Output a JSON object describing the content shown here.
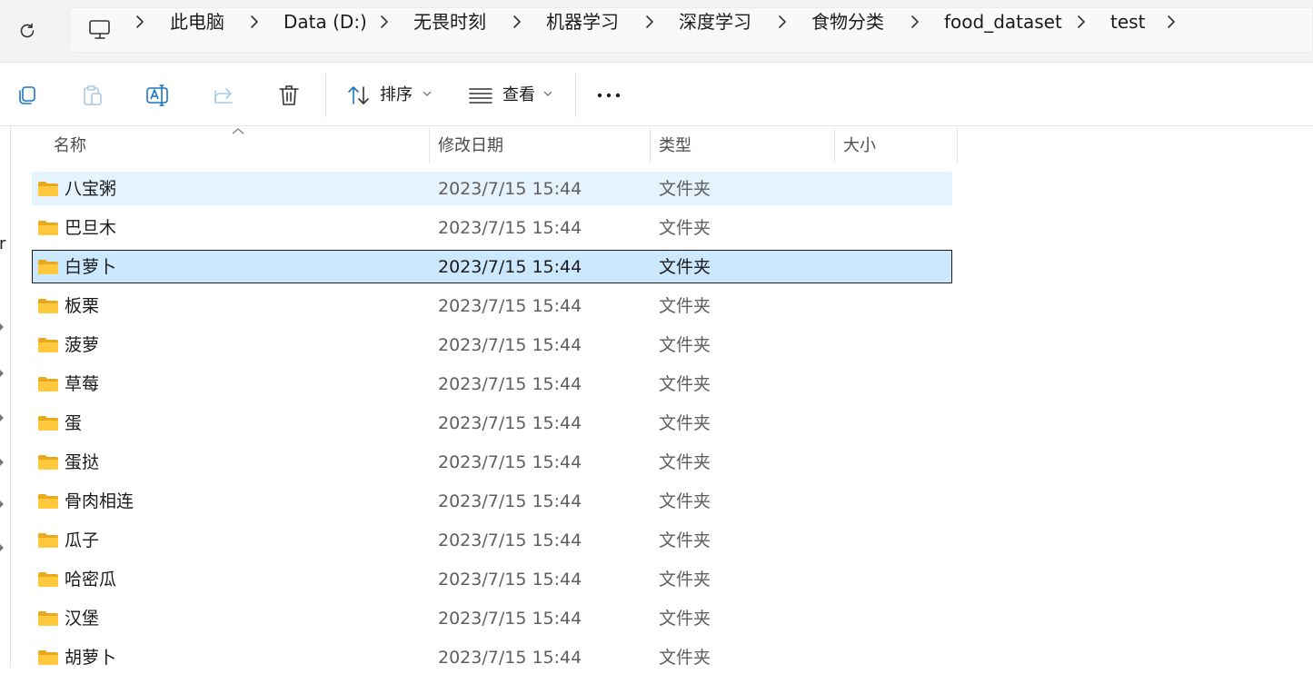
{
  "address_bar": {
    "breadcrumbs": [
      "此电脑",
      "Data (D:)",
      "无畏时刻",
      "机器学习",
      "深度学习",
      "食物分类",
      "food_dataset",
      "test"
    ]
  },
  "toolbar": {
    "sort_label": "排序",
    "view_label": "查看"
  },
  "columns": {
    "name": "名称",
    "date_modified": "修改日期",
    "type": "类型",
    "size": "大小"
  },
  "nav_pane": {
    "partial_text": "r"
  },
  "files": [
    {
      "name": "八宝粥",
      "date": "2023/7/15 15:44",
      "type": "文件夹",
      "state": "hover"
    },
    {
      "name": "巴旦木",
      "date": "2023/7/15 15:44",
      "type": "文件夹",
      "state": ""
    },
    {
      "name": "白萝卜",
      "date": "2023/7/15 15:44",
      "type": "文件夹",
      "state": "selected"
    },
    {
      "name": "板栗",
      "date": "2023/7/15 15:44",
      "type": "文件夹",
      "state": ""
    },
    {
      "name": "菠萝",
      "date": "2023/7/15 15:44",
      "type": "文件夹",
      "state": ""
    },
    {
      "name": "草莓",
      "date": "2023/7/15 15:44",
      "type": "文件夹",
      "state": ""
    },
    {
      "name": "蛋",
      "date": "2023/7/15 15:44",
      "type": "文件夹",
      "state": ""
    },
    {
      "name": "蛋挞",
      "date": "2023/7/15 15:44",
      "type": "文件夹",
      "state": ""
    },
    {
      "name": "骨肉相连",
      "date": "2023/7/15 15:44",
      "type": "文件夹",
      "state": ""
    },
    {
      "name": "瓜子",
      "date": "2023/7/15 15:44",
      "type": "文件夹",
      "state": ""
    },
    {
      "name": "哈密瓜",
      "date": "2023/7/15 15:44",
      "type": "文件夹",
      "state": ""
    },
    {
      "name": "汉堡",
      "date": "2023/7/15 15:44",
      "type": "文件夹",
      "state": ""
    },
    {
      "name": "胡萝卜",
      "date": "2023/7/15 15:44",
      "type": "文件夹",
      "state": ""
    }
  ],
  "colors": {
    "hover_row": "#e5f3ff",
    "selected_row": "#cce8ff",
    "folder_yellow": "#ffc83d"
  },
  "icons": [
    "refresh-icon",
    "computer-icon",
    "chevron-right-icon",
    "copy-icon",
    "paste-icon",
    "rename-icon",
    "share-icon",
    "delete-icon",
    "sort-icon",
    "view-icon",
    "more-icon",
    "folder-icon"
  ]
}
